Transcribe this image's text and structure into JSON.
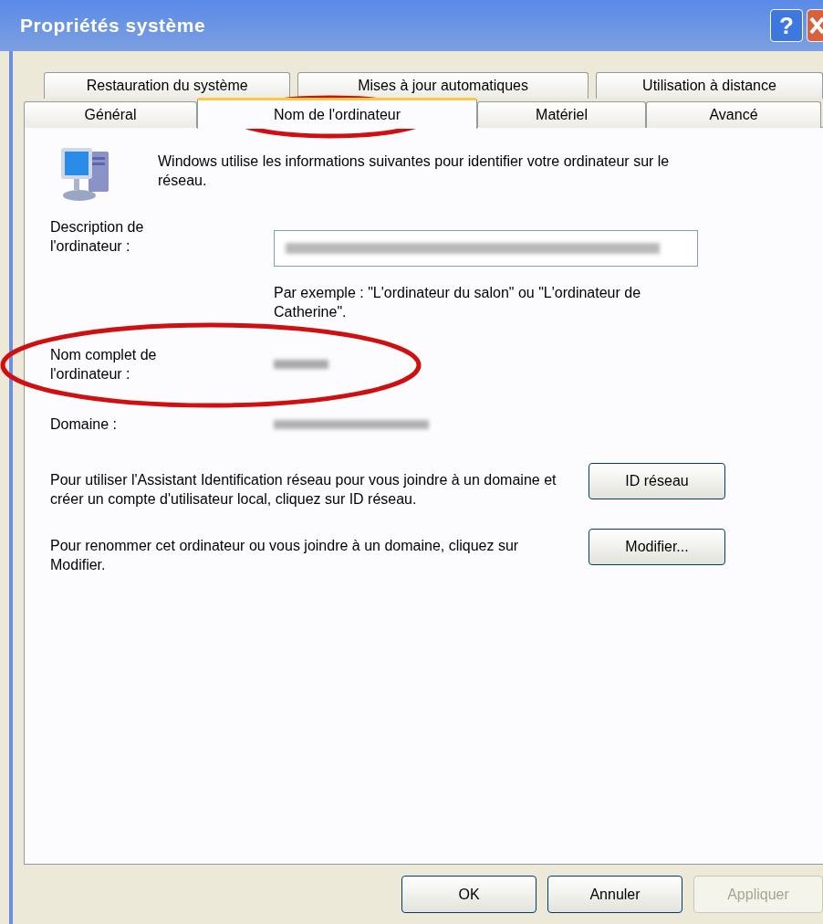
{
  "window": {
    "title": "Propriétés système",
    "help_button": "?"
  },
  "tab_rows": [
    [
      {
        "label": "Restauration du système",
        "selected": false
      },
      {
        "label": "Mises à jour automatiques",
        "selected": false
      },
      {
        "label": "Utilisation à distance",
        "selected": false
      }
    ],
    [
      {
        "label": "Général",
        "selected": false
      },
      {
        "label": "Nom de l'ordinateur",
        "selected": true
      },
      {
        "label": "Matériel",
        "selected": false
      },
      {
        "label": "Avancé",
        "selected": false
      }
    ]
  ],
  "intro": "Windows utilise les informations suivantes pour identifier votre ordinateur sur le réseau.",
  "description": {
    "label": "Description de l'ordinateur :",
    "hint": "Par exemple : \"L'ordinateur du salon\" ou \"L'ordinateur de Catherine\"."
  },
  "full_name": {
    "label": "Nom complet de l'ordinateur :"
  },
  "domain": {
    "label": "Domaine :"
  },
  "actions": [
    {
      "text": "Pour utiliser l'Assistant Identification réseau pour vous joindre à un domaine et créer un compte d'utilisateur local, cliquez sur ID réseau.",
      "button": "ID réseau"
    },
    {
      "text": "Pour renommer cet ordinateur ou vous joindre à un domaine, cliquez sur Modifier.",
      "button": "Modifier..."
    }
  ],
  "buttons": [
    {
      "label": "OK",
      "disabled": false
    },
    {
      "label": "Annuler",
      "disabled": false
    },
    {
      "label": "Appliquer",
      "disabled": true
    }
  ]
}
